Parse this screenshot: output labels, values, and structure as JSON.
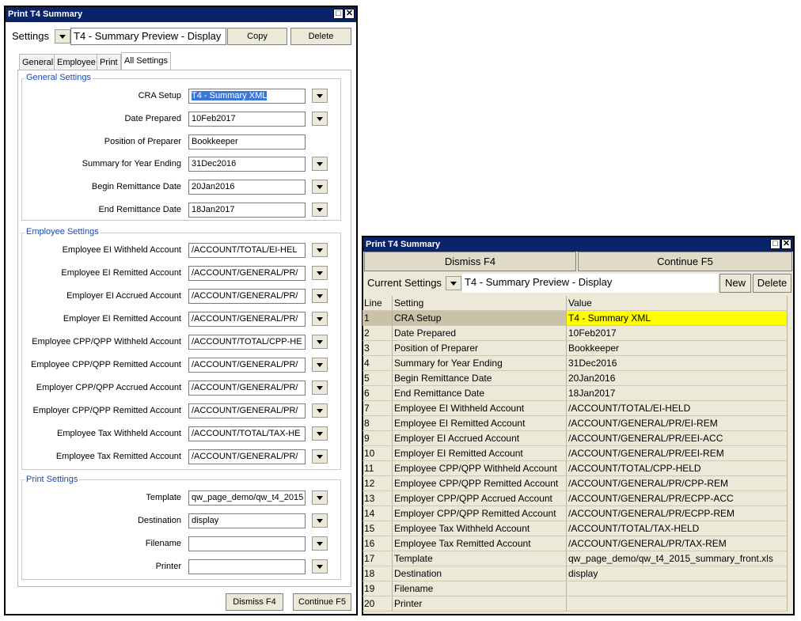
{
  "left": {
    "title": "Print T4 Summary",
    "settings_label": "Settings",
    "settings_value": "T4 - Summary Preview - Display",
    "copy_label": "Copy",
    "delete_label": "Delete",
    "tabs": [
      "General",
      "Employee",
      "Print",
      "All Settings"
    ],
    "active_tab": "All Settings",
    "groups": {
      "general": {
        "title": "General Settings",
        "rows": [
          {
            "label": "CRA Setup",
            "value": "T4 - Summary XML",
            "selected": true,
            "dropdown": true
          },
          {
            "label": "Date Prepared",
            "value": "10Feb2017",
            "dropdown": true
          },
          {
            "label": "Position of Preparer",
            "value": "Bookkeeper",
            "dropdown": false
          },
          {
            "label": "Summary for Year Ending",
            "value": "31Dec2016",
            "dropdown": true
          },
          {
            "label": "Begin Remittance Date",
            "value": "20Jan2016",
            "dropdown": true
          },
          {
            "label": "End Remittance Date",
            "value": "18Jan2017",
            "dropdown": true
          }
        ]
      },
      "employee": {
        "title": "Employee Settings",
        "rows": [
          {
            "label": "Employee EI Withheld Account",
            "value": "/ACCOUNT/TOTAL/EI-HEL"
          },
          {
            "label": "Employee EI Remitted Account",
            "value": "/ACCOUNT/GENERAL/PR/"
          },
          {
            "label": "Employer EI Accrued Account",
            "value": "/ACCOUNT/GENERAL/PR/"
          },
          {
            "label": "Employer EI Remitted Account",
            "value": "/ACCOUNT/GENERAL/PR/"
          },
          {
            "label": "Employee CPP/QPP Withheld Account",
            "value": "/ACCOUNT/TOTAL/CPP-HE"
          },
          {
            "label": "Employee CPP/QPP Remitted Account",
            "value": "/ACCOUNT/GENERAL/PR/"
          },
          {
            "label": "Employer CPP/QPP Accrued Account",
            "value": "/ACCOUNT/GENERAL/PR/"
          },
          {
            "label": "Employer CPP/QPP Remitted Account",
            "value": "/ACCOUNT/GENERAL/PR/"
          },
          {
            "label": "Employee Tax Withheld Account",
            "value": "/ACCOUNT/TOTAL/TAX-HE"
          },
          {
            "label": "Employee Tax Remitted Account",
            "value": "/ACCOUNT/GENERAL/PR/"
          }
        ]
      },
      "print": {
        "title": "Print Settings",
        "rows": [
          {
            "label": "Template",
            "value": "qw_page_demo/qw_t4_2015"
          },
          {
            "label": "Destination",
            "value": "display"
          },
          {
            "label": "Filename",
            "value": ""
          },
          {
            "label": "Printer",
            "value": ""
          }
        ]
      }
    },
    "dismiss_label": "Dismiss F4",
    "continue_label": "Continue F5"
  },
  "right": {
    "title": "Print T4 Summary",
    "dismiss_label": "Dismiss F4",
    "continue_label": "Continue F5",
    "current_settings_label": "Current Settings",
    "current_settings_value": "T4 - Summary Preview - Display",
    "new_label": "New",
    "delete_label": "Delete",
    "columns": [
      "Line",
      "Setting",
      "Value"
    ],
    "rows": [
      {
        "line": "1",
        "setting": "CRA Setup",
        "value": "T4 - Summary XML",
        "selected": true
      },
      {
        "line": "2",
        "setting": "Date Prepared",
        "value": "10Feb2017"
      },
      {
        "line": "3",
        "setting": "Position of Preparer",
        "value": "Bookkeeper"
      },
      {
        "line": "4",
        "setting": "Summary for Year Ending",
        "value": "31Dec2016"
      },
      {
        "line": "5",
        "setting": "Begin Remittance Date",
        "value": "20Jan2016"
      },
      {
        "line": "6",
        "setting": "End Remittance Date",
        "value": "18Jan2017"
      },
      {
        "line": "7",
        "setting": "Employee EI Withheld Account",
        "value": "/ACCOUNT/TOTAL/EI-HELD"
      },
      {
        "line": "8",
        "setting": "Employee EI Remitted Account",
        "value": "/ACCOUNT/GENERAL/PR/EI-REM"
      },
      {
        "line": "9",
        "setting": "Employer EI Accrued Account",
        "value": "/ACCOUNT/GENERAL/PR/EEI-ACC"
      },
      {
        "line": "10",
        "setting": "Employer EI Remitted Account",
        "value": "/ACCOUNT/GENERAL/PR/EEI-REM"
      },
      {
        "line": "11",
        "setting": "Employee CPP/QPP Withheld Account",
        "value": "/ACCOUNT/TOTAL/CPP-HELD"
      },
      {
        "line": "12",
        "setting": "Employee CPP/QPP Remitted Account",
        "value": "/ACCOUNT/GENERAL/PR/CPP-REM"
      },
      {
        "line": "13",
        "setting": "Employer CPP/QPP Accrued Account",
        "value": "/ACCOUNT/GENERAL/PR/ECPP-ACC"
      },
      {
        "line": "14",
        "setting": "Employer CPP/QPP Remitted Account",
        "value": "/ACCOUNT/GENERAL/PR/ECPP-REM"
      },
      {
        "line": "15",
        "setting": "Employee Tax Withheld Account",
        "value": "/ACCOUNT/TOTAL/TAX-HELD"
      },
      {
        "line": "16",
        "setting": "Employee Tax Remitted Account",
        "value": "/ACCOUNT/GENERAL/PR/TAX-REM"
      },
      {
        "line": "17",
        "setting": "Template",
        "value": "qw_page_demo/qw_t4_2015_summary_front.xls"
      },
      {
        "line": "18",
        "setting": "Destination",
        "value": "display"
      },
      {
        "line": "19",
        "setting": "Filename",
        "value": ""
      },
      {
        "line": "20",
        "setting": "Printer",
        "value": ""
      }
    ]
  },
  "colors": {
    "titlebar": "#0a246a",
    "group_title": "#1c47b4",
    "grid_bg": "#ece9d8",
    "grid_selected_setting": "#c9c2a8",
    "grid_selected_value": "#ffff00",
    "selection": "#3c78d8"
  }
}
